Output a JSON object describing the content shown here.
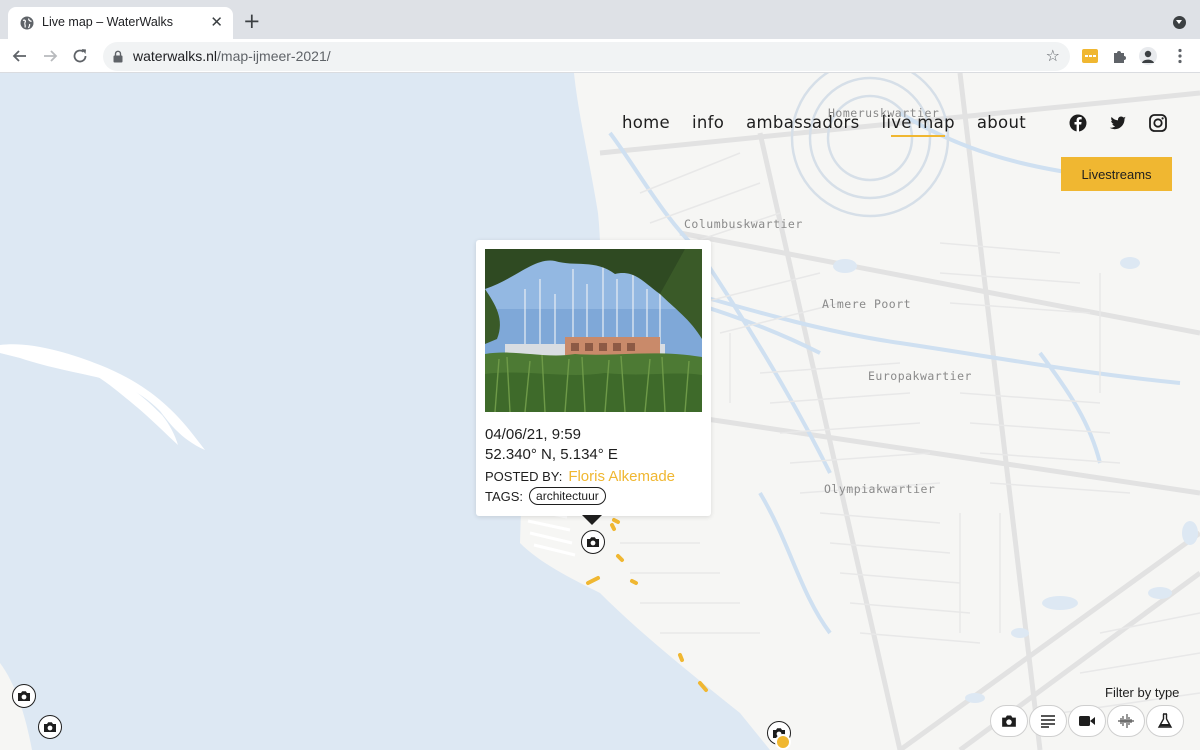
{
  "browser": {
    "tab_title": "Live map – WaterWalks",
    "url_host": "waterwalks.nl",
    "url_path": "/map-ijmeer-2021/"
  },
  "site_nav": {
    "items": [
      "home",
      "info",
      "ambassadors",
      "live map",
      "about"
    ],
    "active": "live map",
    "social": [
      "facebook-icon",
      "twitter-icon",
      "instagram-icon"
    ]
  },
  "livestreams_button": "Livestreams",
  "map": {
    "districts": [
      "Homeruskwartier",
      "Columbuskwartier",
      "Almere Poort",
      "Europakwartier",
      "Olympiakwartier"
    ]
  },
  "popup": {
    "datetime": "04/06/21, 9:59",
    "coordinates": "52.340° N, 5.134° E",
    "posted_by_label": "POSTED BY:",
    "author": "Floris Alkemade",
    "tags_label": "TAGS:",
    "tags": [
      "architectuur"
    ]
  },
  "filter": {
    "label": "Filter by type",
    "types": [
      "camera-icon",
      "text-icon",
      "video-icon",
      "audio-icon",
      "science-icon"
    ]
  },
  "colors": {
    "accent": "#f0b731",
    "water": "#dde8f3",
    "land": "#f6f6f4"
  }
}
